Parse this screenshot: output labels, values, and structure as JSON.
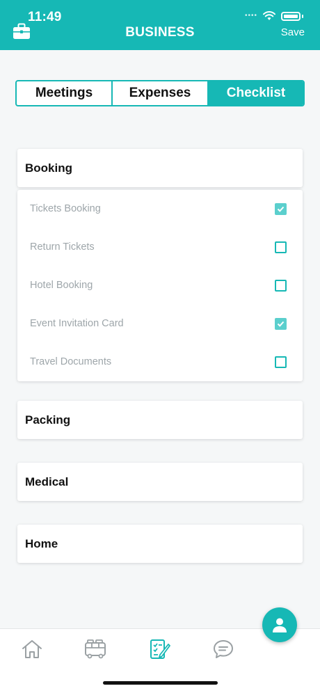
{
  "status_bar": {
    "time": "11:49"
  },
  "header": {
    "title": "BUSINESS",
    "save_label": "Save",
    "left_icon": "briefcase-icon"
  },
  "tabs": [
    {
      "label": "Meetings",
      "active": false
    },
    {
      "label": "Expenses",
      "active": false
    },
    {
      "label": "Checklist",
      "active": true
    }
  ],
  "sections": {
    "booking": {
      "title": "Booking",
      "items": [
        {
          "label": "Tickets Booking",
          "checked": true
        },
        {
          "label": "Return Tickets",
          "checked": false
        },
        {
          "label": "Hotel Booking",
          "checked": false
        },
        {
          "label": "Event Invitation Card",
          "checked": true
        },
        {
          "label": "Travel Documents",
          "checked": false
        }
      ]
    },
    "packing": {
      "title": "Packing"
    },
    "medical": {
      "title": "Medical"
    },
    "home": {
      "title": "Home"
    }
  },
  "tabbar": [
    {
      "icon": "home-icon",
      "active": false
    },
    {
      "icon": "bus-icon",
      "active": false
    },
    {
      "icon": "checklist-icon",
      "active": true
    },
    {
      "icon": "chat-icon",
      "active": false
    }
  ],
  "fab": {
    "icon": "person-icon"
  },
  "colors": {
    "accent": "#16b8b5",
    "checked": "#5bcfcd",
    "muted_text": "#9ea6aa",
    "inactive_icon": "#9aa0a3"
  }
}
